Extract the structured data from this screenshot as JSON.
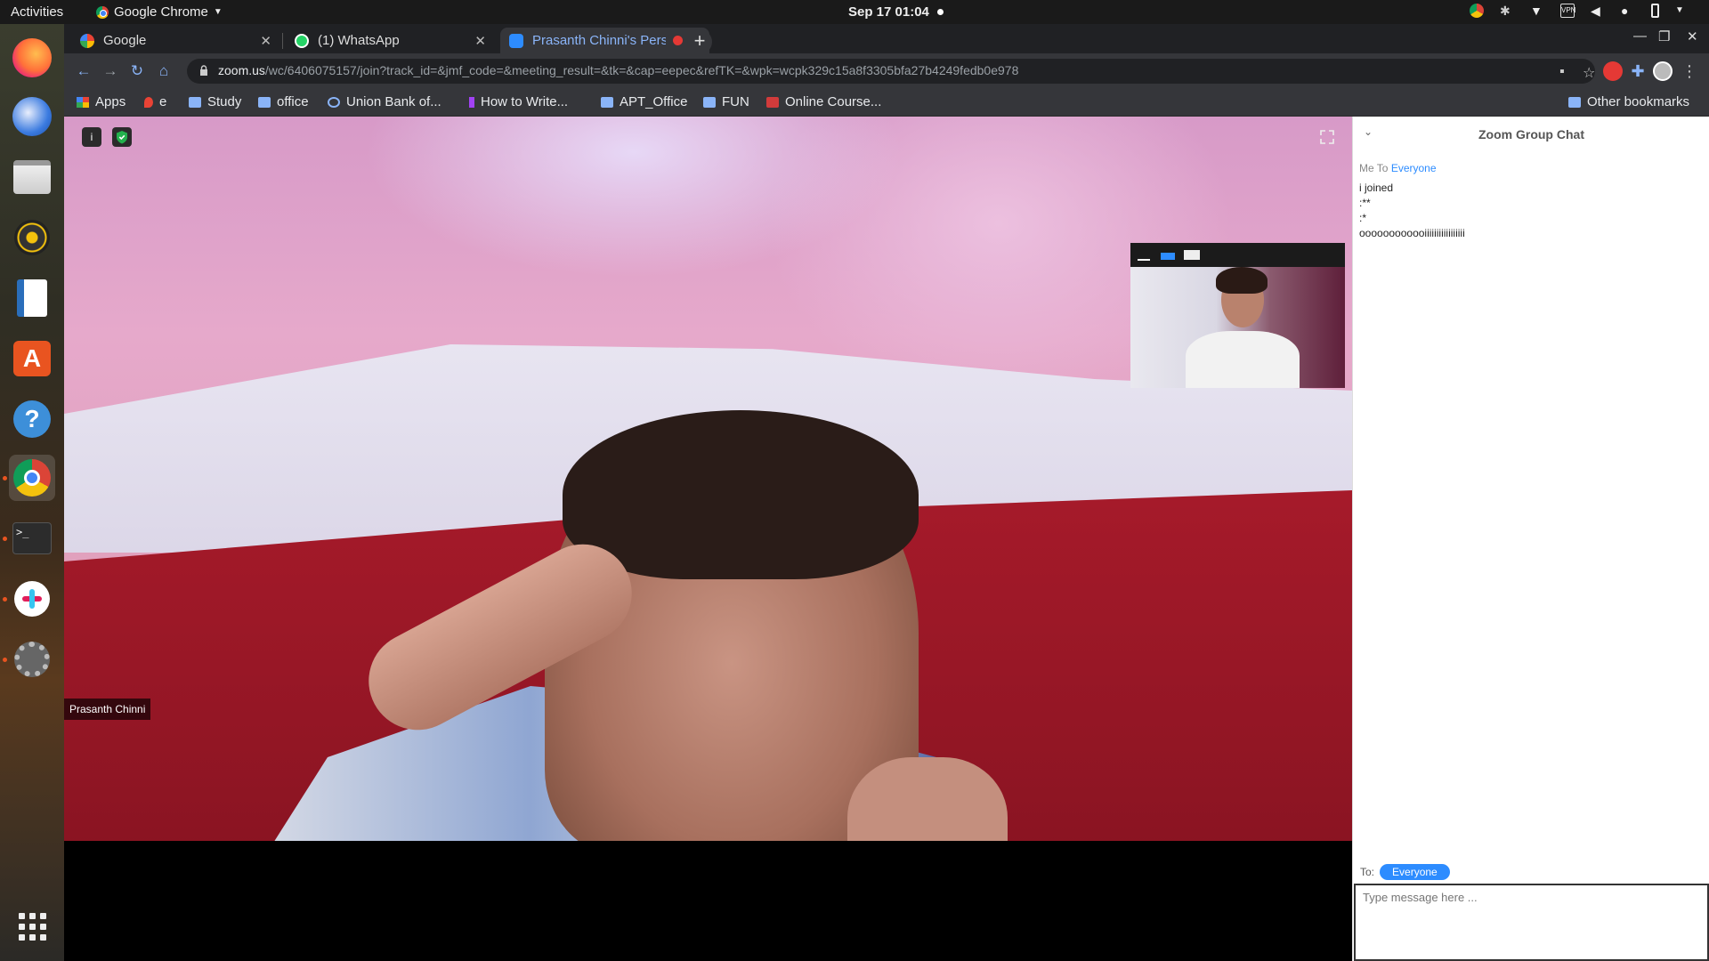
{
  "topbar": {
    "activities": "Activities",
    "app_name": "Google Chrome",
    "clock": "Sep 17  01:04"
  },
  "dock": {
    "items": [
      "firefox-icon",
      "thunderbird-icon",
      "files-icon",
      "rhythmbox-icon",
      "writer-icon",
      "software-icon",
      "help-icon",
      "chrome-icon",
      "terminal-icon",
      "slack-icon",
      "settings-icon",
      "app-grid-icon"
    ]
  },
  "tabs": [
    {
      "title": "Google",
      "favicon": "google-icon",
      "active": false
    },
    {
      "title": "(1) WhatsApp",
      "favicon": "whatsapp-icon",
      "active": false
    },
    {
      "title": "Prasanth Chinni's Pers",
      "favicon": "zoom-icon",
      "active": true
    }
  ],
  "toolbar": {
    "url_host": "zoom.us",
    "url_path": "/wc/6406075157/join?track_id=&jmf_code=&meeting_result=&tk=&cap=eepec&refTK=&wpk=wcpk329c15a8f3305bfa27b4249fedb0e978"
  },
  "bookmarks": {
    "items": [
      "Apps",
      "e",
      "Study",
      "office",
      "Union Bank of...",
      "How to Write...",
      "APT_Office",
      "FUN",
      "Online Course..."
    ],
    "other": "Other bookmarks"
  },
  "video": {
    "participant_name": "Prasanth Chinni",
    "info_icon": "i"
  },
  "chat": {
    "title": "Zoom Group Chat",
    "from": "Me To",
    "to": "Everyone",
    "messages": [
      "i joined",
      ":**",
      ":*",
      "oooooooooooiiiiiiiiiiiiiiiii"
    ],
    "to_label": "To:",
    "to_value": "Everyone",
    "input_placeholder": "Type message here ..."
  },
  "colors": {
    "accent": "#2d8cff",
    "tab_active_text": "#8ab4f8",
    "chrome_dark": "#202124",
    "chrome_toolbar": "#35363a"
  }
}
